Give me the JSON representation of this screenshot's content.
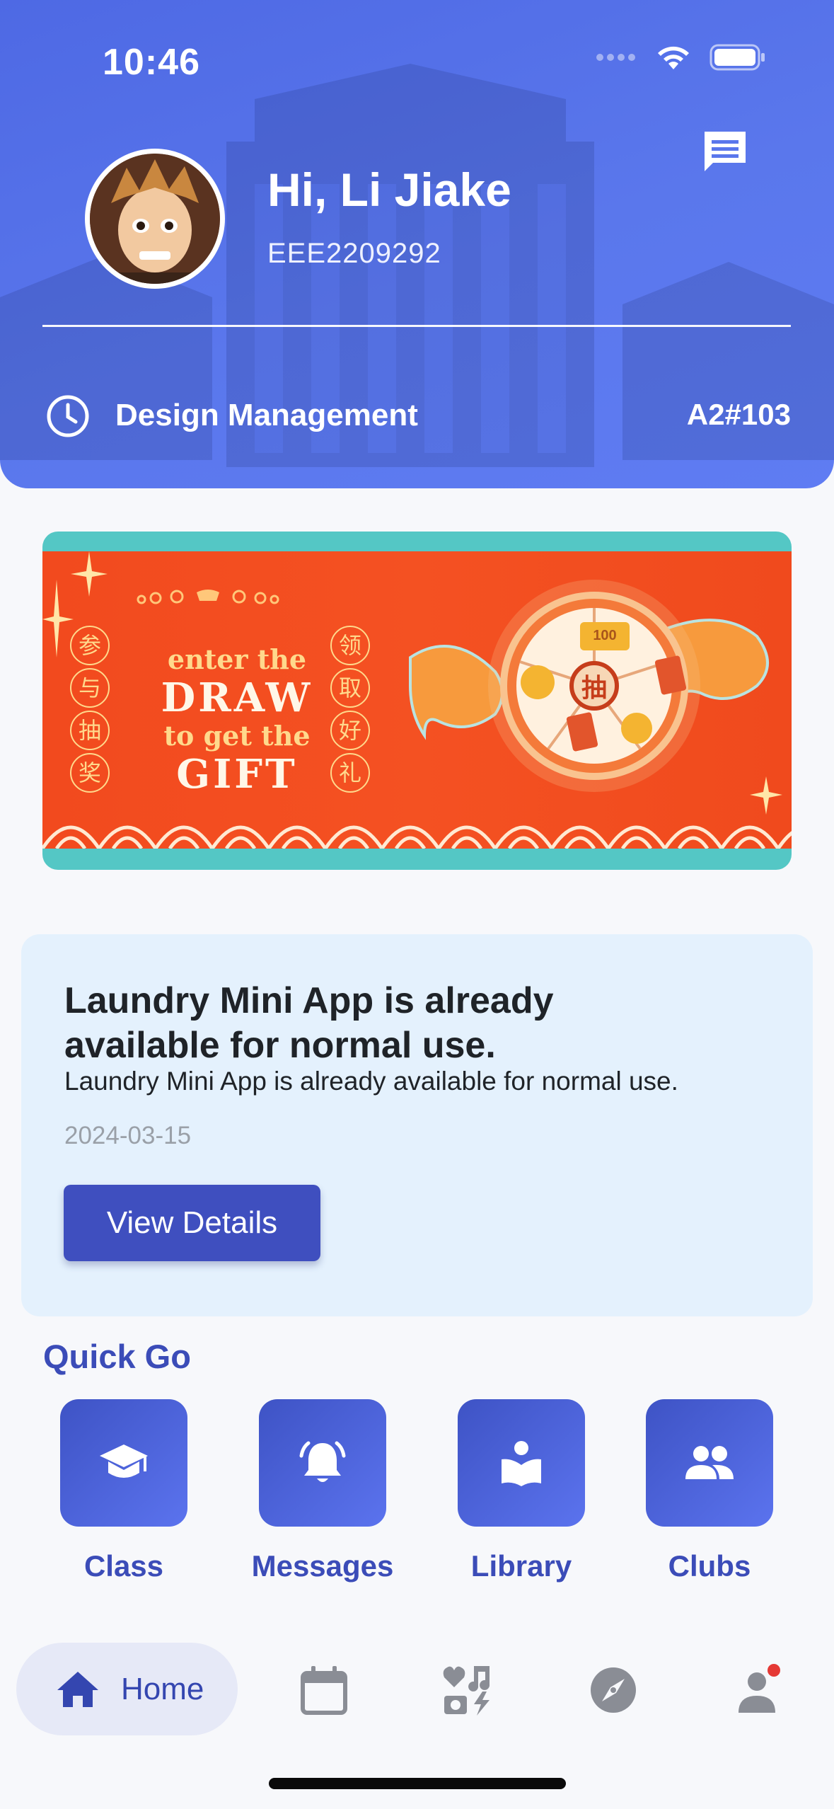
{
  "status_bar": {
    "time": "10:46"
  },
  "header": {
    "greeting": "Hi, Li Jiake",
    "student_id": "EEE2209292",
    "current_class": "Design Management",
    "room": "A2#103"
  },
  "banner": {
    "line1": "enter the",
    "line2": "DRAW",
    "line3": "to get the",
    "line4": "GIFT",
    "left_chars": [
      "参",
      "与",
      "抽",
      "奖"
    ],
    "right_chars": [
      "领",
      "取",
      "好",
      "礼"
    ],
    "wheel_center": "抽",
    "coupon_text": "100"
  },
  "notice": {
    "title": "Laundry Mini App is already available for normal use.",
    "body": "Laundry Mini App is already available for normal use.",
    "date": "2024-03-15",
    "button_label": "View Details"
  },
  "quick_go": {
    "title": "Quick Go",
    "items": [
      {
        "label": "Class",
        "icon": "graduation-cap-icon"
      },
      {
        "label": "Messages",
        "icon": "bell-icon"
      },
      {
        "label": "Library",
        "icon": "reader-book-icon"
      },
      {
        "label": "Clubs",
        "icon": "people-icon"
      }
    ]
  },
  "bottom_nav": {
    "home_label": "Home",
    "items": [
      "home-icon",
      "calendar-icon",
      "interests-icon",
      "compass-icon",
      "profile-icon"
    ]
  },
  "colors": {
    "header_blue": "#5a77ec",
    "accent": "#3f4fbf",
    "notice_bg": "#e4f1fd",
    "banner_red": "#f24a1e",
    "banner_teal": "#54c7c5",
    "notification_dot": "#e53935"
  }
}
